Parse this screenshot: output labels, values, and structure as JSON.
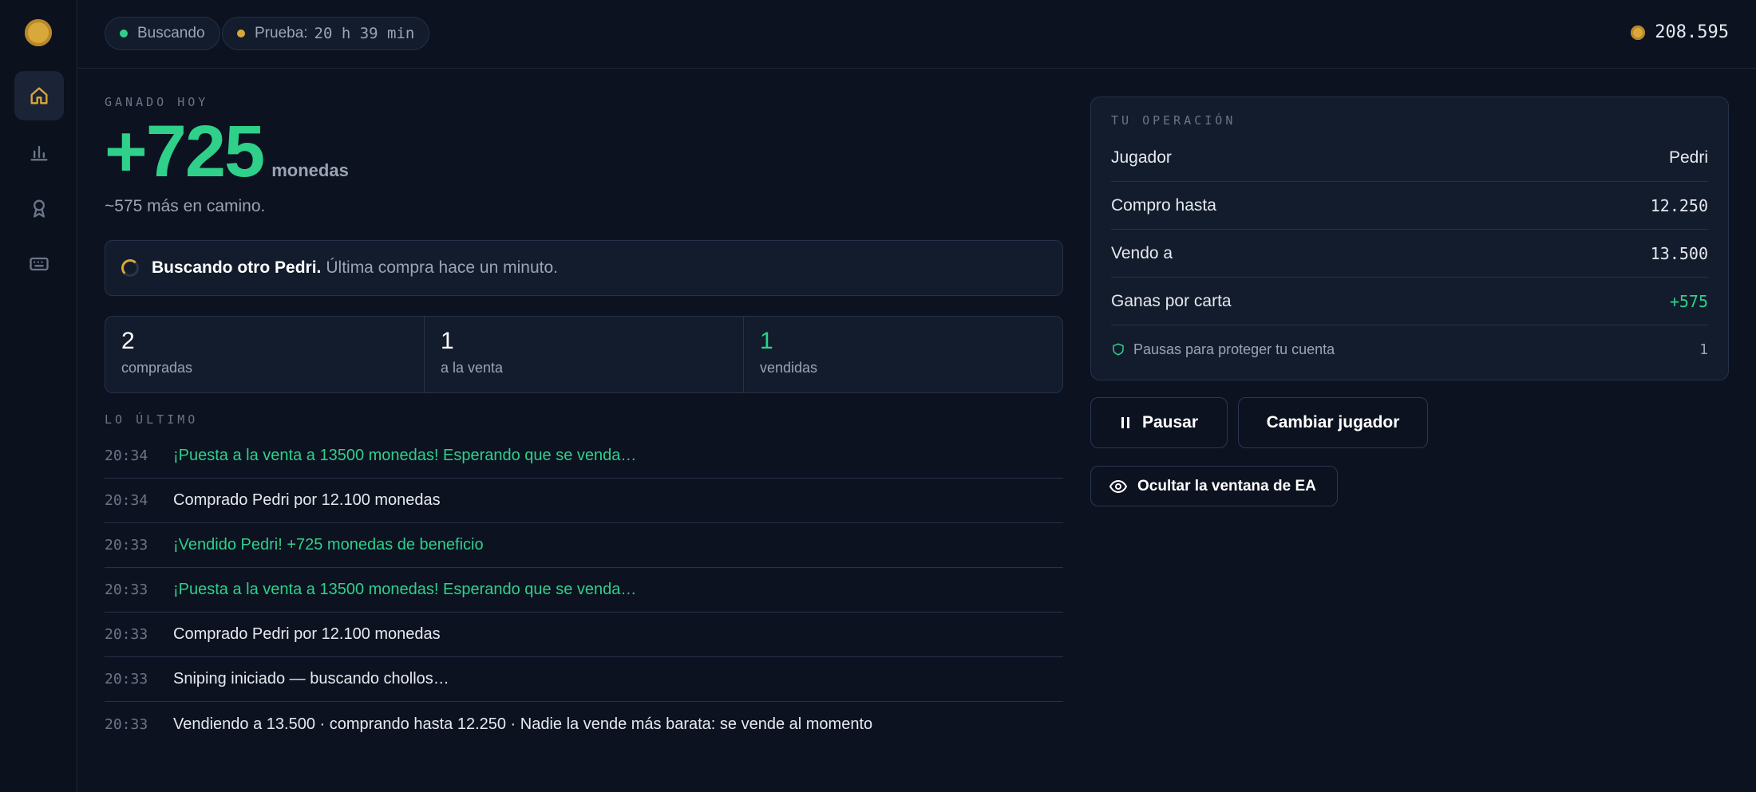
{
  "topbar": {
    "status_label": "Buscando",
    "trial_label": "Prueba:",
    "trial_value": "20 h 39 min",
    "balance": "208.595"
  },
  "colors": {
    "accent_green": "#2fd08a",
    "gold": "#d8a83a",
    "bg": "#0c1220"
  },
  "sidebar": {
    "items": [
      {
        "icon": "home-icon",
        "active": true
      },
      {
        "icon": "bar-chart-icon",
        "active": false
      },
      {
        "icon": "award-icon",
        "active": false
      },
      {
        "icon": "keyboard-icon",
        "active": false
      }
    ]
  },
  "earnings": {
    "label": "GANADO HOY",
    "amount": "+725",
    "unit": "monedas",
    "pending": "~575 más en camino."
  },
  "search_status": {
    "strong": "Buscando otro Pedri.",
    "rest": "Última compra hace un minuto."
  },
  "stats": [
    {
      "value": "2",
      "label": "compradas"
    },
    {
      "value": "1",
      "label": "a la venta"
    },
    {
      "value": "1",
      "label": "vendidas"
    }
  ],
  "log": {
    "label": "LO ÚLTIMO",
    "rows": [
      {
        "time": "20:34",
        "msg": "¡Puesta a la venta a 13500 monedas! Esperando que se venda…",
        "highlight": true
      },
      {
        "time": "20:34",
        "msg": "Comprado Pedri por 12.100 monedas",
        "highlight": false
      },
      {
        "time": "20:33",
        "msg": "¡Vendido Pedri! +725 monedas de beneficio",
        "highlight": true
      },
      {
        "time": "20:33",
        "msg": "¡Puesta a la venta a 13500 monedas! Esperando que se venda…",
        "highlight": true
      },
      {
        "time": "20:33",
        "msg": "Comprado Pedri por 12.100 monedas",
        "highlight": false
      },
      {
        "time": "20:33",
        "msg": "Sniping iniciado — buscando chollos…",
        "highlight": false
      },
      {
        "time": "20:33",
        "msg": "Vendiendo a 13.500 · comprando hasta 12.250 · Nadie la vende más barata: se vende al momento",
        "highlight": false
      }
    ]
  },
  "operation": {
    "title": "TU OPERACIÓN",
    "rows": [
      {
        "label": "Jugador",
        "value": "Pedri"
      },
      {
        "label": "Compro hasta",
        "value": "12.250"
      },
      {
        "label": "Vendo a",
        "value": "13.500"
      },
      {
        "label": "Ganas por carta",
        "value": "+575"
      }
    ],
    "footer_label": "Pausas para proteger tu cuenta",
    "footer_value": "1"
  },
  "actions": {
    "pause": "Pausar",
    "change_player": "Cambiar jugador",
    "hide_window": "Ocultar la ventana de EA"
  }
}
